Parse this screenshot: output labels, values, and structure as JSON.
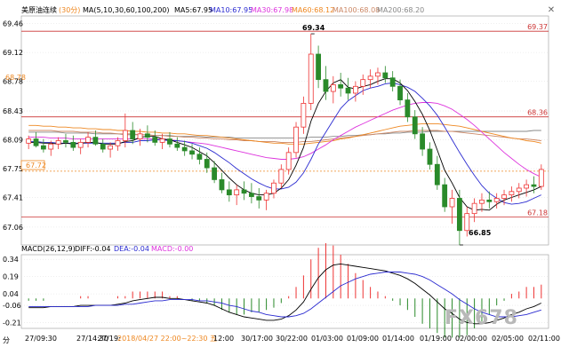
{
  "header": {
    "main": {
      "name": "美原油连续",
      "period": "(30分)",
      "params": "MA(5,10,30,60,100,200)",
      "ma5": "MA5:67.95",
      "ma10": "MA10:67.95",
      "ma30": "MA30:67.98",
      "ma60": "MA60:68.12",
      "ma100": "MA100:68.08",
      "ma200": "MA200:68.20"
    },
    "macd": {
      "params": "MACD(26,12,9)",
      "diff": "DIFF:-0.04",
      "dea": "DEA:-0.04",
      "macd": "MACD:-0.00"
    }
  },
  "annotations": {
    "high": "69.34",
    "low": "66.85",
    "last": "67.72",
    "level_a": "68.78"
  },
  "xaxis": {
    "labels": [
      "27/09:30",
      "27/14:30",
      "27/19:",
      "2018/04/27 22:00~22:30 五",
      "12:00",
      "30/17:00",
      "30/22:00",
      "01/03:00",
      "01/09:00",
      "01/14:00",
      "01/19:00",
      "02/00:00",
      "02/05:00",
      "02/11:00"
    ],
    "left_tag": "分"
  },
  "watermark": "FX678",
  "colors": {
    "up": "#ee3333",
    "down": "#2a8a2a",
    "ma5": "#000000",
    "ma10": "#2a2ad0",
    "ma30": "#dd33dd",
    "ma60": "#ee8822",
    "ma100": "#cc8866",
    "ma200": "#888888",
    "level": "#cc3333",
    "last": "#ee8822",
    "diff": "#000000",
    "dea": "#2a2ad0"
  },
  "chart_data": [
    {
      "type": "candlestick",
      "yaxis_labels": [
        "69.46",
        "69.12",
        "68.78",
        "68.43",
        "68.09",
        "67.75",
        "67.41",
        "67.06"
      ],
      "right_labels": [
        "69.37",
        "68.36",
        "67.18"
      ],
      "ylim": [
        66.85,
        69.55
      ],
      "levels": [
        69.37,
        68.36,
        67.18
      ],
      "last_price": 67.72,
      "candles": [
        [
          68.05,
          68.14,
          67.98,
          68.1
        ],
        [
          68.1,
          68.18,
          68.0,
          68.02
        ],
        [
          68.02,
          68.1,
          67.94,
          67.98
        ],
        [
          67.98,
          68.08,
          67.9,
          68.04
        ],
        [
          68.04,
          68.12,
          67.98,
          68.08
        ],
        [
          68.08,
          68.16,
          68.0,
          68.06
        ],
        [
          68.06,
          68.14,
          67.96,
          68.0
        ],
        [
          68.0,
          68.1,
          67.92,
          68.06
        ],
        [
          68.06,
          68.18,
          68.0,
          68.12
        ],
        [
          68.12,
          68.2,
          68.02,
          68.04
        ],
        [
          68.04,
          68.1,
          67.94,
          67.98
        ],
        [
          67.98,
          68.06,
          67.88,
          68.02
        ],
        [
          68.02,
          68.12,
          67.96,
          68.08
        ],
        [
          68.08,
          68.4,
          68.0,
          68.2
        ],
        [
          68.2,
          68.3,
          68.04,
          68.1
        ],
        [
          68.1,
          68.22,
          68.02,
          68.16
        ],
        [
          68.16,
          68.26,
          68.06,
          68.12
        ],
        [
          68.12,
          68.2,
          68.02,
          68.06
        ],
        [
          68.06,
          68.16,
          67.98,
          68.1
        ],
        [
          68.1,
          68.18,
          68.0,
          68.04
        ],
        [
          68.04,
          68.12,
          67.96,
          68.0
        ],
        [
          68.0,
          68.08,
          67.9,
          67.96
        ],
        [
          67.96,
          68.04,
          67.86,
          67.92
        ],
        [
          67.92,
          68.0,
          67.8,
          67.86
        ],
        [
          67.86,
          67.94,
          67.7,
          67.76
        ],
        [
          67.76,
          67.84,
          67.58,
          67.62
        ],
        [
          67.62,
          67.7,
          67.46,
          67.5
        ],
        [
          67.5,
          67.6,
          67.36,
          67.44
        ],
        [
          67.44,
          67.56,
          67.32,
          67.5
        ],
        [
          67.5,
          67.6,
          67.38,
          67.46
        ],
        [
          67.46,
          67.58,
          67.34,
          67.42
        ],
        [
          67.42,
          67.52,
          67.28,
          67.38
        ],
        [
          67.38,
          67.5,
          67.26,
          67.46
        ],
        [
          67.46,
          67.62,
          67.4,
          67.58
        ],
        [
          67.58,
          67.8,
          67.52,
          67.74
        ],
        [
          67.74,
          68.0,
          67.68,
          67.94
        ],
        [
          67.94,
          68.3,
          67.88,
          68.24
        ],
        [
          68.24,
          68.6,
          68.16,
          68.52
        ],
        [
          68.52,
          69.34,
          68.44,
          69.1
        ],
        [
          69.1,
          69.2,
          68.7,
          68.8
        ],
        [
          68.8,
          68.96,
          68.56,
          68.66
        ],
        [
          68.66,
          68.84,
          68.52,
          68.74
        ],
        [
          68.74,
          68.88,
          68.6,
          68.7
        ],
        [
          68.7,
          68.82,
          68.56,
          68.64
        ],
        [
          68.64,
          68.78,
          68.54,
          68.72
        ],
        [
          68.72,
          68.86,
          68.62,
          68.8
        ],
        [
          68.8,
          68.92,
          68.7,
          68.84
        ],
        [
          68.84,
          68.94,
          68.74,
          68.88
        ],
        [
          68.88,
          68.96,
          68.76,
          68.82
        ],
        [
          68.82,
          68.9,
          68.66,
          68.72
        ],
        [
          68.72,
          68.8,
          68.5,
          68.56
        ],
        [
          68.56,
          68.64,
          68.3,
          68.36
        ],
        [
          68.36,
          68.44,
          68.1,
          68.16
        ],
        [
          68.16,
          68.24,
          67.9,
          67.98
        ],
        [
          67.98,
          68.06,
          67.74,
          67.8
        ],
        [
          67.8,
          67.9,
          67.5,
          67.56
        ],
        [
          67.56,
          67.64,
          67.24,
          67.3
        ],
        [
          67.3,
          67.5,
          67.1,
          67.4
        ],
        [
          67.4,
          67.5,
          66.85,
          67.02
        ],
        [
          67.02,
          67.3,
          66.95,
          67.22
        ],
        [
          67.22,
          67.4,
          67.12,
          67.34
        ],
        [
          67.34,
          67.46,
          67.24,
          67.38
        ],
        [
          67.38,
          67.48,
          67.28,
          67.36
        ],
        [
          67.36,
          67.46,
          67.28,
          67.4
        ],
        [
          67.4,
          67.5,
          67.32,
          67.44
        ],
        [
          67.44,
          67.54,
          67.36,
          67.48
        ],
        [
          67.48,
          67.58,
          67.4,
          67.52
        ],
        [
          67.52,
          67.62,
          67.42,
          67.56
        ],
        [
          67.56,
          67.66,
          67.46,
          67.54
        ],
        [
          67.54,
          67.8,
          67.5,
          67.74
        ]
      ],
      "ma5": [
        68.06,
        68.06,
        68.05,
        68.05,
        68.04,
        68.05,
        68.04,
        68.05,
        68.06,
        68.06,
        68.04,
        68.04,
        68.04,
        68.07,
        68.08,
        68.12,
        68.13,
        68.13,
        68.1,
        68.09,
        68.06,
        68.03,
        68.0,
        67.95,
        67.9,
        67.82,
        67.73,
        67.64,
        67.56,
        67.5,
        67.46,
        67.44,
        67.44,
        67.46,
        67.52,
        67.62,
        67.79,
        68.0,
        68.31,
        68.52,
        68.66,
        68.76,
        68.8,
        68.71,
        68.69,
        68.72,
        68.74,
        68.78,
        68.81,
        68.81,
        68.76,
        68.67,
        68.54,
        68.39,
        68.2,
        67.97,
        67.73,
        67.58,
        67.41,
        67.3,
        67.26,
        67.27,
        67.26,
        67.33,
        67.38,
        67.41,
        67.44,
        67.47,
        67.5,
        67.54
      ],
      "ma10": [
        68.07,
        68.07,
        68.06,
        68.06,
        68.05,
        68.05,
        68.05,
        68.05,
        68.05,
        68.05,
        68.05,
        68.05,
        68.05,
        68.06,
        68.06,
        68.08,
        68.08,
        68.09,
        68.09,
        68.08,
        68.08,
        68.07,
        68.05,
        68.02,
        67.99,
        67.94,
        67.88,
        67.82,
        67.75,
        67.69,
        67.63,
        67.58,
        67.54,
        67.51,
        67.51,
        67.53,
        67.59,
        67.7,
        67.86,
        68.04,
        68.18,
        68.32,
        68.46,
        68.55,
        68.61,
        68.67,
        68.7,
        68.72,
        68.75,
        68.76,
        68.74,
        68.71,
        68.66,
        68.58,
        68.49,
        68.38,
        68.24,
        68.09,
        67.94,
        67.8,
        67.67,
        67.55,
        67.46,
        67.4,
        67.35,
        67.33,
        67.34,
        67.36,
        67.4,
        67.44
      ],
      "ma30": [
        68.12,
        68.12,
        68.12,
        68.11,
        68.11,
        68.11,
        68.1,
        68.1,
        68.1,
        68.1,
        68.1,
        68.1,
        68.1,
        68.1,
        68.1,
        68.1,
        68.1,
        68.1,
        68.09,
        68.09,
        68.08,
        68.07,
        68.06,
        68.05,
        68.04,
        68.02,
        68.0,
        67.98,
        67.96,
        67.94,
        67.92,
        67.9,
        67.88,
        67.87,
        67.86,
        67.86,
        67.87,
        67.89,
        67.93,
        67.98,
        68.03,
        68.09,
        68.14,
        68.19,
        68.24,
        68.28,
        68.32,
        68.36,
        68.4,
        68.44,
        68.47,
        68.5,
        68.52,
        68.53,
        68.53,
        68.52,
        68.49,
        68.45,
        68.39,
        68.33,
        68.26,
        68.18,
        68.1,
        68.02,
        67.94,
        67.87,
        67.8,
        67.74,
        67.69,
        67.65
      ],
      "ma60": [
        68.26,
        68.26,
        68.25,
        68.25,
        68.24,
        68.24,
        68.23,
        68.23,
        68.22,
        68.22,
        68.21,
        68.21,
        68.2,
        68.2,
        68.19,
        68.19,
        68.18,
        68.18,
        68.17,
        68.17,
        68.16,
        68.16,
        68.15,
        68.14,
        68.14,
        68.13,
        68.12,
        68.11,
        68.1,
        68.09,
        68.08,
        68.07,
        68.06,
        68.05,
        68.05,
        68.04,
        68.04,
        68.04,
        68.05,
        68.06,
        68.07,
        68.08,
        68.1,
        68.11,
        68.13,
        68.15,
        68.17,
        68.19,
        68.21,
        68.23,
        68.25,
        68.26,
        68.27,
        68.28,
        68.28,
        68.28,
        68.27,
        68.26,
        68.25,
        68.23,
        68.21,
        68.19,
        68.17,
        68.15,
        68.13,
        68.11,
        68.1,
        68.08,
        68.07,
        68.05
      ],
      "ma100": [
        68.2,
        68.2,
        68.2,
        68.2,
        68.19,
        68.19,
        68.19,
        68.18,
        68.18,
        68.18,
        68.17,
        68.17,
        68.16,
        68.16,
        68.16,
        68.15,
        68.15,
        68.14,
        68.14,
        68.13,
        68.13,
        68.12,
        68.12,
        68.11,
        68.11,
        68.1,
        68.1,
        68.09,
        68.09,
        68.08,
        68.08,
        68.07,
        68.07,
        68.07,
        68.06,
        68.06,
        68.06,
        68.07,
        68.07,
        68.08,
        68.09,
        68.1,
        68.11,
        68.12,
        68.13,
        68.14,
        68.15,
        68.16,
        68.17,
        68.18,
        68.19,
        68.19,
        68.2,
        68.2,
        68.2,
        68.2,
        68.19,
        68.19,
        68.18,
        68.17,
        68.16,
        68.15,
        68.14,
        68.13,
        68.12,
        68.11,
        68.1,
        68.1,
        68.09,
        68.08
      ],
      "ma200": [
        68.18,
        68.18,
        68.18,
        68.18,
        68.18,
        68.17,
        68.17,
        68.17,
        68.17,
        68.16,
        68.16,
        68.16,
        68.16,
        68.15,
        68.15,
        68.15,
        68.15,
        68.14,
        68.14,
        68.14,
        68.13,
        68.13,
        68.13,
        68.13,
        68.12,
        68.12,
        68.12,
        68.12,
        68.11,
        68.11,
        68.11,
        68.11,
        68.11,
        68.11,
        68.11,
        68.11,
        68.11,
        68.11,
        68.12,
        68.12,
        68.12,
        68.13,
        68.13,
        68.14,
        68.14,
        68.15,
        68.15,
        68.16,
        68.16,
        68.17,
        68.17,
        68.18,
        68.18,
        68.18,
        68.19,
        68.19,
        68.19,
        68.19,
        68.19,
        68.19,
        68.19,
        68.19,
        68.19,
        68.19,
        68.19,
        68.19,
        68.19,
        68.19,
        68.2,
        68.2
      ]
    },
    {
      "type": "macd",
      "yaxis_labels": [
        "0.34",
        "0.19",
        "0.04",
        "-0.06",
        "-0.21"
      ],
      "ylim": [
        -0.26,
        0.38
      ],
      "diff": [
        -0.08,
        -0.08,
        -0.08,
        -0.07,
        -0.07,
        -0.07,
        -0.07,
        -0.06,
        -0.06,
        -0.06,
        -0.06,
        -0.06,
        -0.05,
        -0.04,
        -0.02,
        -0.01,
        0.0,
        0.01,
        0.01,
        0.0,
        0.0,
        -0.01,
        -0.02,
        -0.03,
        -0.04,
        -0.06,
        -0.09,
        -0.12,
        -0.14,
        -0.16,
        -0.17,
        -0.18,
        -0.19,
        -0.19,
        -0.18,
        -0.15,
        -0.1,
        -0.03,
        0.08,
        0.18,
        0.25,
        0.29,
        0.3,
        0.29,
        0.28,
        0.27,
        0.26,
        0.25,
        0.24,
        0.22,
        0.2,
        0.17,
        0.13,
        0.08,
        0.03,
        -0.03,
        -0.09,
        -0.13,
        -0.18,
        -0.21,
        -0.22,
        -0.22,
        -0.21,
        -0.19,
        -0.17,
        -0.14,
        -0.12,
        -0.09,
        -0.07,
        -0.04
      ],
      "dea": [
        -0.07,
        -0.07,
        -0.07,
        -0.07,
        -0.07,
        -0.07,
        -0.07,
        -0.07,
        -0.07,
        -0.06,
        -0.06,
        -0.06,
        -0.06,
        -0.05,
        -0.05,
        -0.04,
        -0.03,
        -0.02,
        -0.02,
        -0.01,
        -0.01,
        -0.01,
        -0.01,
        -0.02,
        -0.02,
        -0.03,
        -0.04,
        -0.06,
        -0.07,
        -0.09,
        -0.11,
        -0.12,
        -0.14,
        -0.15,
        -0.16,
        -0.16,
        -0.15,
        -0.13,
        -0.09,
        -0.04,
        0.01,
        0.06,
        0.11,
        0.14,
        0.17,
        0.19,
        0.21,
        0.22,
        0.23,
        0.23,
        0.23,
        0.22,
        0.21,
        0.19,
        0.16,
        0.12,
        0.08,
        0.04,
        -0.01,
        -0.05,
        -0.09,
        -0.12,
        -0.14,
        -0.16,
        -0.16,
        -0.16,
        -0.15,
        -0.14,
        -0.12,
        -0.1
      ]
    }
  ]
}
